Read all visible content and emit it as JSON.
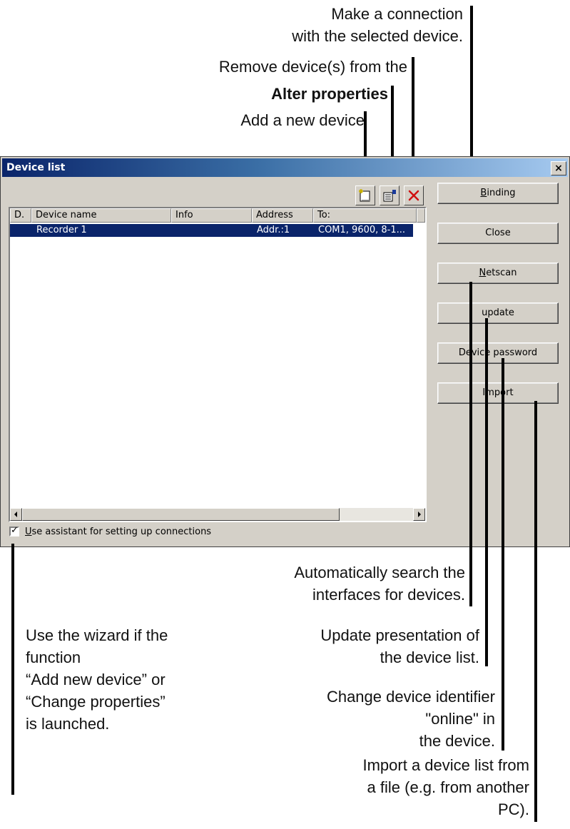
{
  "dialog": {
    "title": "Device list",
    "close_glyph": "×",
    "toolbar": {
      "new_icon": "new-device-icon",
      "properties_icon": "properties-icon",
      "delete_icon": "delete-icon"
    },
    "columns": [
      "D.",
      "Device name",
      "Info",
      "Address",
      "To:"
    ],
    "rows": [
      {
        "d": "",
        "name": "Recorder 1",
        "info": "",
        "address": "Addr.:1",
        "to": "COM1, 9600, 8-1..."
      }
    ],
    "buttons": {
      "binding_u": "B",
      "binding_rest": "inding",
      "close": "Close",
      "netscan_u": "N",
      "netscan_rest": "etscan",
      "update": "update",
      "device_password": "Device password",
      "import": "Import"
    },
    "checkbox": {
      "checked": true,
      "label_u": "U",
      "label_rest": "se assistant for setting up connections"
    }
  },
  "callouts": {
    "make_connection": [
      "Make a connection",
      "with the selected device."
    ],
    "remove_devices": "Remove device(s) from the",
    "alter_properties": "Alter properties",
    "add_device": "Add a new device",
    "auto_search": [
      "Automatically search the",
      "interfaces for devices."
    ],
    "wizard": [
      "Use the wizard if the",
      "function",
      "“Add new device” or",
      "“Change properties”",
      "is launched."
    ],
    "update_presentation": [
      "Update presentation of",
      "the device list."
    ],
    "change_identifier": [
      "Change device identifier",
      "\"online\" in",
      "the device."
    ],
    "import_list": [
      "Import a device list from",
      "a file (e.g. from another",
      "PC)."
    ]
  }
}
